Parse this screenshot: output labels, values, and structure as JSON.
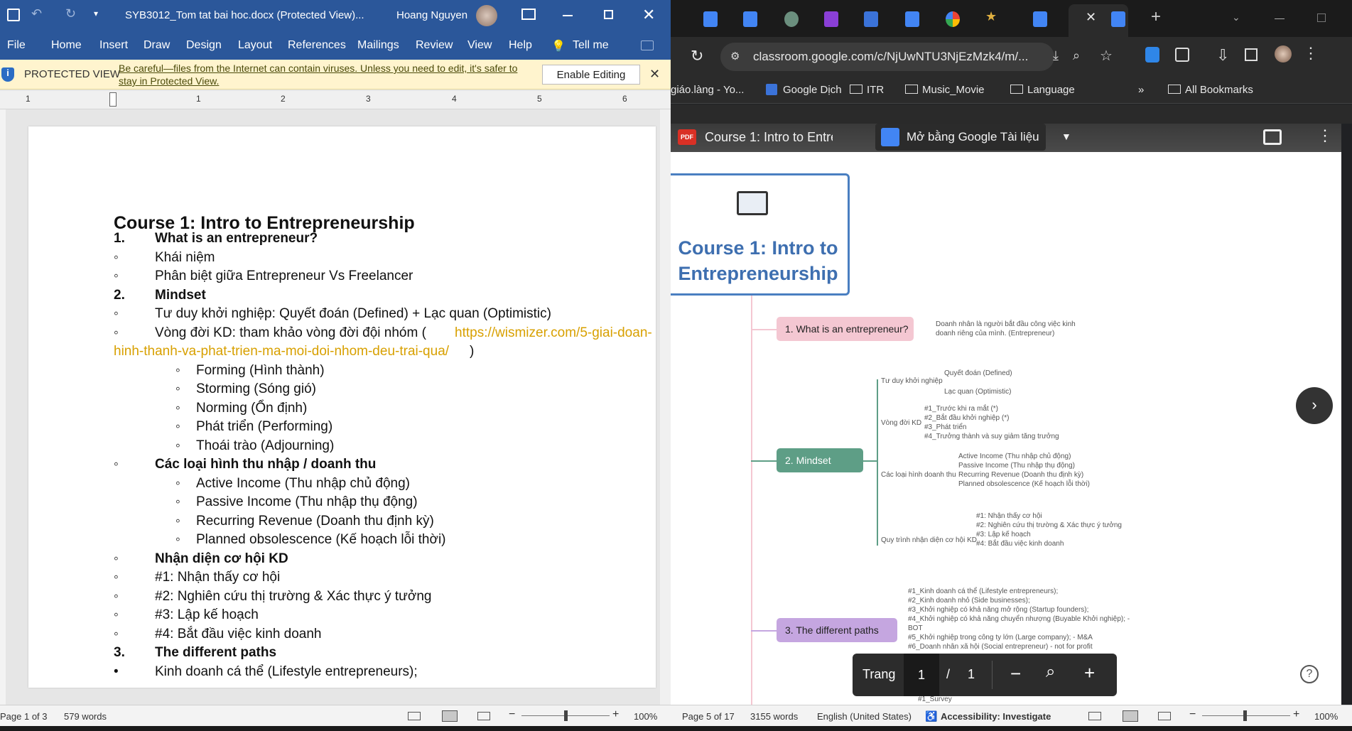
{
  "word": {
    "title": "SYB3012_Tom tat bai hoc.docx (Protected View)...",
    "user": "Hoang Nguyen",
    "file_label": "File",
    "tabs": [
      "Home",
      "Insert",
      "Draw",
      "Design",
      "Layout",
      "References",
      "Mailings",
      "Review",
      "View",
      "Help"
    ],
    "tell_me": "Tell me",
    "protected": {
      "label": "PROTECTED VIEW",
      "message": "Be careful—files from the Internet can contain viruses. Unless you need to edit, it's safer to stay in Protected View.",
      "enable_button": "Enable Editing"
    },
    "ruler_numbers": [
      "1",
      "1",
      "2",
      "3",
      "4",
      "5",
      "6"
    ],
    "document": {
      "heading": "Course 1: Intro to Entrepreneurship",
      "lines": [
        {
          "marker": "1.",
          "text": "What is an entrepreneur?",
          "bold": true,
          "indent": 1
        },
        {
          "marker": "◦",
          "text": "Khái niệm",
          "bold": false,
          "indent": 1
        },
        {
          "marker": "◦",
          "text": "Phân biệt giữa Entrepreneur Vs Freelancer",
          "bold": false,
          "indent": 1
        },
        {
          "marker": "2.",
          "text": "Mindset",
          "bold": true,
          "indent": 1
        },
        {
          "marker": "◦",
          "text": "Tư duy khởi nghiệp: Quyết đoán (Defined) + Lạc quan (Optimistic)",
          "bold": false,
          "indent": 1
        },
        {
          "marker": "◦",
          "text": "Vòng đời KD: tham khảo vòng đời đội nhóm (",
          "bold": false,
          "indent": 1,
          "link": "https://wismizer.com/5-giai-doan-",
          "link2": "hinh-thanh-va-phat-trien-ma-moi-doi-nhom-deu-trai-qua/",
          "tail": ")"
        },
        {
          "marker": "◦",
          "text": "Forming (Hình thành)",
          "bold": false,
          "indent": 2
        },
        {
          "marker": "◦",
          "text": "Storming (Sóng gió)",
          "bold": false,
          "indent": 2
        },
        {
          "marker": "◦",
          "text": "Norming (Ổn định)",
          "bold": false,
          "indent": 2
        },
        {
          "marker": "◦",
          "text": "Phát triển (Performing)",
          "bold": false,
          "indent": 2
        },
        {
          "marker": "◦",
          "text": "Thoái trào (Adjourning)",
          "bold": false,
          "indent": 2
        },
        {
          "marker": "◦",
          "text": "Các loại hình thu nhập / doanh thu",
          "bold": true,
          "indent": 1
        },
        {
          "marker": "◦",
          "text": "Active Income (Thu nhập chủ động)",
          "bold": false,
          "indent": 2
        },
        {
          "marker": "◦",
          "text": "Passive Income (Thu nhập thụ động)",
          "bold": false,
          "indent": 2
        },
        {
          "marker": "◦",
          "text": "Recurring Revenue (Doanh thu định kỳ)",
          "bold": false,
          "indent": 2
        },
        {
          "marker": "◦",
          "text": "Planned obsolescence (Kế hoạch lỗi thời)",
          "bold": false,
          "indent": 2
        },
        {
          "marker": "◦",
          "text": "Nhận diện cơ hội KD",
          "bold": true,
          "indent": 1
        },
        {
          "marker": "◦",
          "text": "#1: Nhận thấy cơ hội",
          "bold": false,
          "indent": 1
        },
        {
          "marker": "◦",
          "text": "#2: Nghiên cứu thị trường & Xác thực ý tưởng",
          "bold": false,
          "indent": 1
        },
        {
          "marker": "◦",
          "text": "#3: Lập kế hoạch",
          "bold": false,
          "indent": 1
        },
        {
          "marker": "◦",
          "text": "#4: Bắt đầu việc kinh doanh",
          "bold": false,
          "indent": 1
        },
        {
          "marker": "3.",
          "text": "The different paths",
          "bold": true,
          "indent": 1
        },
        {
          "marker": "•",
          "text": "Kinh doanh cá thể (Lifestyle entrepreneurs);",
          "bold": false,
          "indent": 1
        }
      ]
    },
    "status": {
      "page": "Page 1 of 3",
      "words": "579 words",
      "zoom": "100%"
    }
  },
  "chrome": {
    "url": "classroom.google.com/c/NjUwNTU3NjEzMzk4/m/...",
    "bookmarks": [
      "giáo.làng - Yo...",
      "Google Dịch",
      "ITR",
      "Music_Movie",
      "Language",
      "All Bookmarks"
    ],
    "pdf": {
      "title": "Course 1: Intro to Entrepreneurship",
      "open_with": "Mở bằng Google Tài liệu",
      "title_box": "Course 1: Intro to Entrepreneurship",
      "nodes": {
        "n1": "1. What is an entrepreneur?",
        "n1_desc": [
          "Doanh nhân là người bắt đầu công việc kinh",
          "doanh riêng của mình. (Entrepreneur)"
        ],
        "n2": "2. Mindset",
        "tu_duy": "Tư duy khởi nghiệp",
        "tu_duy_items": [
          "Quyết đoán (Defined)",
          "Lạc quan (Optimistic)"
        ],
        "vong_doi": "Vòng đời KD",
        "vong_doi_items": [
          "#1_Trước khi ra mắt (*)",
          "#2_Bắt đầu khởi nghiệp (*)",
          "#3_Phát triển",
          "#4_Trưởng thành và suy giảm tăng trưởng"
        ],
        "loai_hinh": "Các loại hình doanh thu",
        "loai_hinh_items": [
          "Active Income (Thu nhập chủ động)",
          "Passive Income (Thu nhập thụ động)",
          "Recurring Revenue (Doanh thu định kỳ)",
          "Planned obsolescence (Kế hoạch lỗi thời)"
        ],
        "quy_trinh": "Quy trình nhận diện cơ hội KD",
        "quy_trinh_items": [
          "#1: Nhận thấy cơ hội",
          "#2: Nghiên cứu thị trường & Xác thực ý tưởng",
          "#3: Lập kế hoạch",
          "#4: Bắt đầu việc kinh doanh"
        ],
        "n3": "3. The different paths",
        "n3_items": [
          "#1_Kinh doanh cá thể (Lifestyle entrepreneurs);",
          "#2_Kinh doanh nhỏ (Side businesses);",
          "#3_Khởi nghiệp có khả năng mở rộng (Startup founders);",
          "#4_Khởi nghiệp có khả năng chuyển nhượng (Buyable Khởi nghiệp); -",
          "BOT",
          "#5_Khởi nghiệp trong công ty lớn (Large company); - M&A",
          "#6_Doanh nhân xã hội (Social entrepreneur) - not for profit"
        ],
        "survey": "#1_Survey"
      },
      "toolbar": {
        "page_label": "Trang",
        "current": "1",
        "sep": "/",
        "total": "1"
      }
    },
    "status": {
      "page": "Page 5 of 17",
      "words": "3155 words",
      "language": "English (United States)",
      "accessibility": "Accessibility: Investigate",
      "zoom": "100%"
    }
  },
  "colors": {
    "word_blue": "#2b579a",
    "link_orange": "#d8a000",
    "node_pink": "#f4c7d2",
    "node_green": "#5e9e86",
    "node_purple": "#c5a6e0",
    "title_border": "#4a7fc1",
    "title_text": "#3e6fb0"
  }
}
